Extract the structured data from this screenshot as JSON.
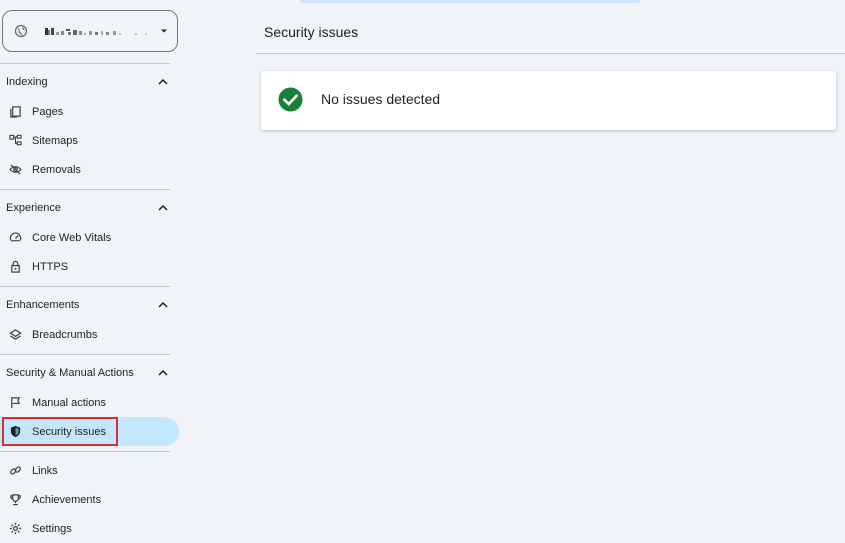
{
  "main": {
    "page_title": "Security issues",
    "status_message": "No issues detected"
  },
  "sidebar": {
    "property_name": "redacted property",
    "sections": {
      "indexing": "Indexing",
      "experience": "Experience",
      "enhancements": "Enhancements",
      "security": "Security & Manual Actions"
    },
    "items": {
      "pages": "Pages",
      "sitemaps": "Sitemaps",
      "removals": "Removals",
      "core_web_vitals": "Core Web Vitals",
      "https": "HTTPS",
      "breadcrumbs": "Breadcrumbs",
      "manual_actions": "Manual actions",
      "security_issues": "Security issues",
      "links": "Links",
      "achievements": "Achievements",
      "settings": "Settings"
    },
    "active_item": "security_issues"
  },
  "colors": {
    "background": "#f0f4f9",
    "active_item_bg": "#c2e7ff",
    "success_green": "#188038",
    "highlight_border": "#d93025"
  },
  "icons": {
    "property": "globe-icon",
    "pages": "pages-icon",
    "sitemaps": "sitemap-icon",
    "removals": "eye-off-icon",
    "core_web_vitals": "gauge-icon",
    "https": "lock-icon",
    "breadcrumbs": "layers-icon",
    "manual_actions": "flag-icon",
    "security_issues": "shield-icon",
    "links": "link-icon",
    "achievements": "trophy-icon",
    "settings": "gear-icon",
    "status": "check-circle-icon"
  }
}
